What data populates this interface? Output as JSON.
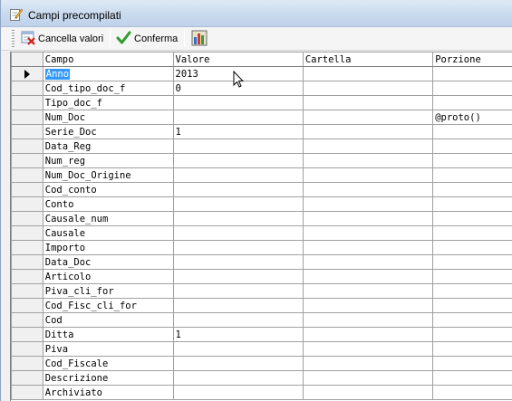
{
  "window": {
    "title": "Campi precompilati"
  },
  "toolbar": {
    "cancel_label": "Cancella valori",
    "confirm_label": "Conferma"
  },
  "grid": {
    "columns": [
      "Campo",
      "Valore",
      "Cartella",
      "Porzione"
    ],
    "rows": [
      {
        "campo": "Anno",
        "valore": "2013",
        "cartella": "",
        "porzione": ""
      },
      {
        "campo": "Cod_tipo_doc_f",
        "valore": "0",
        "cartella": "",
        "porzione": ""
      },
      {
        "campo": "Tipo_doc_f",
        "valore": "",
        "cartella": "",
        "porzione": ""
      },
      {
        "campo": "Num_Doc",
        "valore": "",
        "cartella": "",
        "porzione": "@proto()"
      },
      {
        "campo": "Serie_Doc",
        "valore": "1",
        "cartella": "",
        "porzione": ""
      },
      {
        "campo": "Data_Reg",
        "valore": "",
        "cartella": "",
        "porzione": ""
      },
      {
        "campo": "Num_reg",
        "valore": "",
        "cartella": "",
        "porzione": ""
      },
      {
        "campo": "Num_Doc_Origine",
        "valore": "",
        "cartella": "",
        "porzione": ""
      },
      {
        "campo": "Cod_conto",
        "valore": "",
        "cartella": "",
        "porzione": ""
      },
      {
        "campo": "Conto",
        "valore": "",
        "cartella": "",
        "porzione": ""
      },
      {
        "campo": "Causale_num",
        "valore": "",
        "cartella": "",
        "porzione": ""
      },
      {
        "campo": "Causale",
        "valore": "",
        "cartella": "",
        "porzione": ""
      },
      {
        "campo": "Importo",
        "valore": "",
        "cartella": "",
        "porzione": ""
      },
      {
        "campo": "Data_Doc",
        "valore": "",
        "cartella": "",
        "porzione": ""
      },
      {
        "campo": "Articolo",
        "valore": "",
        "cartella": "",
        "porzione": ""
      },
      {
        "campo": "Piva_cli_for",
        "valore": "",
        "cartella": "",
        "porzione": ""
      },
      {
        "campo": "Cod_Fisc_cli_for",
        "valore": "",
        "cartella": "",
        "porzione": ""
      },
      {
        "campo": "Cod",
        "valore": "",
        "cartella": "",
        "porzione": ""
      },
      {
        "campo": "Ditta",
        "valore": "1",
        "cartella": "",
        "porzione": ""
      },
      {
        "campo": "Piva",
        "valore": "",
        "cartella": "",
        "porzione": ""
      },
      {
        "campo": "Cod_Fiscale",
        "valore": "",
        "cartella": "",
        "porzione": ""
      },
      {
        "campo": "Descrizione",
        "valore": "",
        "cartella": "",
        "porzione": ""
      },
      {
        "campo": "Archiviato",
        "valore": "",
        "cartella": "",
        "porzione": ""
      }
    ],
    "current_row_index": 0
  },
  "colors": {
    "selection": "#3399ff",
    "confirm_check": "#2e9c2e",
    "cancel_x": "#d42020"
  },
  "icons": {
    "title": "edit-pencil-icon",
    "cancel": "clear-values-icon",
    "confirm": "checkmark-icon",
    "extra": "report-icon",
    "row_indicator": "current-row-arrow-icon",
    "pointer": "mouse-cursor-icon"
  }
}
